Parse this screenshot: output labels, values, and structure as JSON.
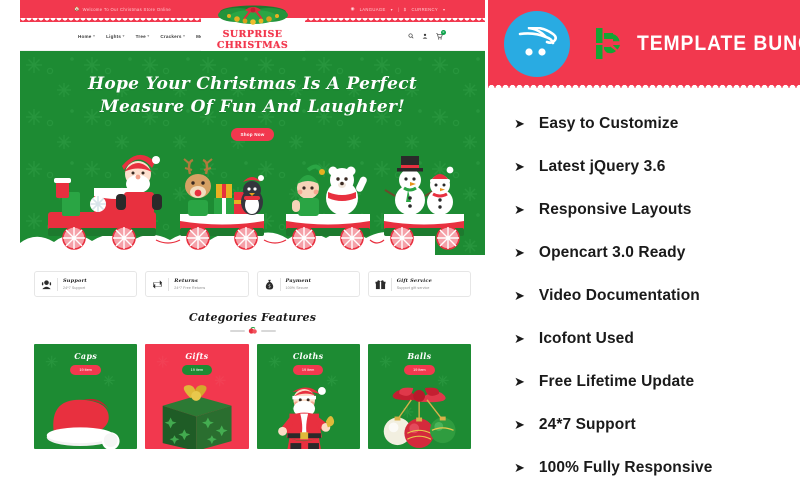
{
  "preview": {
    "topbar": {
      "home_icon": "home-icon",
      "welcome_text": "Welcome To Our Christmas Store Online",
      "language_icon": "globe-icon",
      "language_label": "LANGUAGE",
      "separator": "|",
      "currency_symbol": "$",
      "currency_label": "CURRENCY",
      "caret": "⌄"
    },
    "logo": {
      "line1": "Surprise",
      "line2": "Christmas",
      "ornament": "garland-icon"
    },
    "nav": {
      "items": [
        {
          "label": "Home",
          "caret": "▾"
        },
        {
          "label": "Lights",
          "caret": "▾"
        },
        {
          "label": "Tree",
          "caret": "▾"
        },
        {
          "label": "Crackers",
          "caret": "▾"
        },
        {
          "label": "More",
          "caret": "▾"
        }
      ],
      "icons": [
        {
          "name": "search-icon"
        },
        {
          "name": "user-icon"
        },
        {
          "name": "cart-icon"
        }
      ],
      "cart_count": "0"
    },
    "hero": {
      "title_line1": "Hope Your Christmas Is A Perfect",
      "title_line2": "Measure Of Fun And Laughter!",
      "cta_label": "Shop Now",
      "illustration": "christmas-train-illustration"
    },
    "services": [
      {
        "icon": "headset-support-icon",
        "title": "Support",
        "subtitle": "24*7 Support"
      },
      {
        "icon": "return-arrows-icon",
        "title": "Returns",
        "subtitle": "24*7 Free Returns"
      },
      {
        "icon": "money-bag-icon",
        "title": "Payment",
        "subtitle": "100% Secure"
      },
      {
        "icon": "gift-box-icon",
        "title": "Gift Service",
        "subtitle": "Support gift service"
      }
    ],
    "categories_section": {
      "heading": "Categories Features",
      "cards": [
        {
          "name": "Caps",
          "count_label": "19 item",
          "color": "#1d8b33",
          "image": "santa-hat-image"
        },
        {
          "name": "Gifts",
          "count_label": "19 item",
          "color": "#f2384e",
          "image": "gift-box-image"
        },
        {
          "name": "Cloths",
          "count_label": "19 item",
          "color": "#1d8b33",
          "image": "santa-figure-image"
        },
        {
          "name": "Balls",
          "count_label": "19 item",
          "color": "#1d8b33",
          "image": "christmas-baubles-image"
        }
      ]
    }
  },
  "brand": {
    "cart_icon": "opencart-cart-icon",
    "logo_mark": "templatebunch-b-mark-icon",
    "name": "Template Bunch",
    "bar_color": "#f2384e",
    "circle_color": "#29abe2",
    "mark_color": "#0aa34a"
  },
  "features": {
    "arrow_glyph": "➤",
    "items": [
      {
        "label": "Easy to Customize"
      },
      {
        "label": "Latest jQuery 3.6"
      },
      {
        "label": "Responsive Layouts"
      },
      {
        "label": "Opencart 3.0 Ready"
      },
      {
        "label": "Video Documentation"
      },
      {
        "label": "Icofont Used"
      },
      {
        "label": "Free Lifetime Update"
      },
      {
        "label": "24*7 Support"
      },
      {
        "label": "100% Fully Responsive"
      }
    ]
  },
  "decor": {
    "dots_color": "#6cb87f"
  }
}
